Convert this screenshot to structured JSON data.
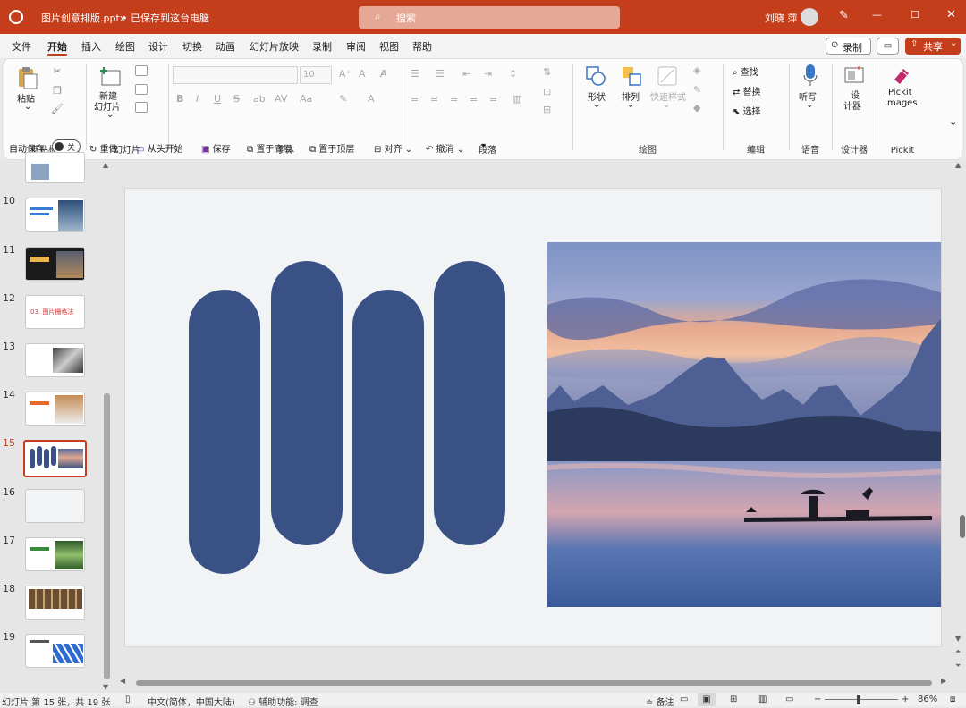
{
  "window": {
    "filename": "图片创意排版.pptx",
    "save_status": "• 已保存到这台电脑",
    "search_placeholder": "搜索",
    "user_name": "刘晓 萍",
    "brand_color": "#c43e1c"
  },
  "menu": {
    "tabs": [
      "文件",
      "开始",
      "插入",
      "绘图",
      "设计",
      "切换",
      "动画",
      "幻灯片放映",
      "录制",
      "审阅",
      "视图",
      "帮助"
    ],
    "active_tab": "开始",
    "record_label": "录制",
    "share_label": "共享"
  },
  "ribbon": {
    "clipboard": {
      "paste": "粘贴",
      "group": "剪贴板"
    },
    "slides": {
      "new_slide_1": "新建",
      "new_slide_2": "幻灯片",
      "group": "幻灯片"
    },
    "font": {
      "size": "10",
      "group": "字体"
    },
    "paragraph": {
      "group": "段落"
    },
    "drawing": {
      "shapes": "形状",
      "arrange": "排列",
      "quick_styles": "快速样式",
      "group": "绘图"
    },
    "editing": {
      "find": "查找",
      "replace": "替换",
      "select": "选择",
      "group": "编辑"
    },
    "voice": {
      "dictate": "听写",
      "group": "语音"
    },
    "designer": {
      "label_1": "设",
      "label_2": "计器",
      "group": "设计器"
    },
    "pickit": {
      "label_1": "Pickit",
      "label_2": "Images",
      "group": "Pickit"
    }
  },
  "qat": {
    "autosave": "自动保存",
    "toggle_off": "关",
    "redo": "重做",
    "from_start": "从头开始",
    "save": "保存",
    "bring_back": "置于底层",
    "bring_front": "置于顶层",
    "align": "对齐",
    "undo": "撤消"
  },
  "slides_panel": {
    "numbers": [
      "10",
      "11",
      "12",
      "13",
      "14",
      "15",
      "16",
      "17",
      "18",
      "19"
    ],
    "active": "15",
    "slide12_text": "03. 图片栅格法"
  },
  "slide": {
    "pill_color": "#3a5186",
    "image_desc_icon": "landscape-photo"
  },
  "status": {
    "slide_info": "幻灯片 第 15 张，共 19 张",
    "language": "中文(简体，中国大陆)",
    "accessibility": "辅助功能: 调查",
    "notes": "备注",
    "zoom": "86%"
  }
}
